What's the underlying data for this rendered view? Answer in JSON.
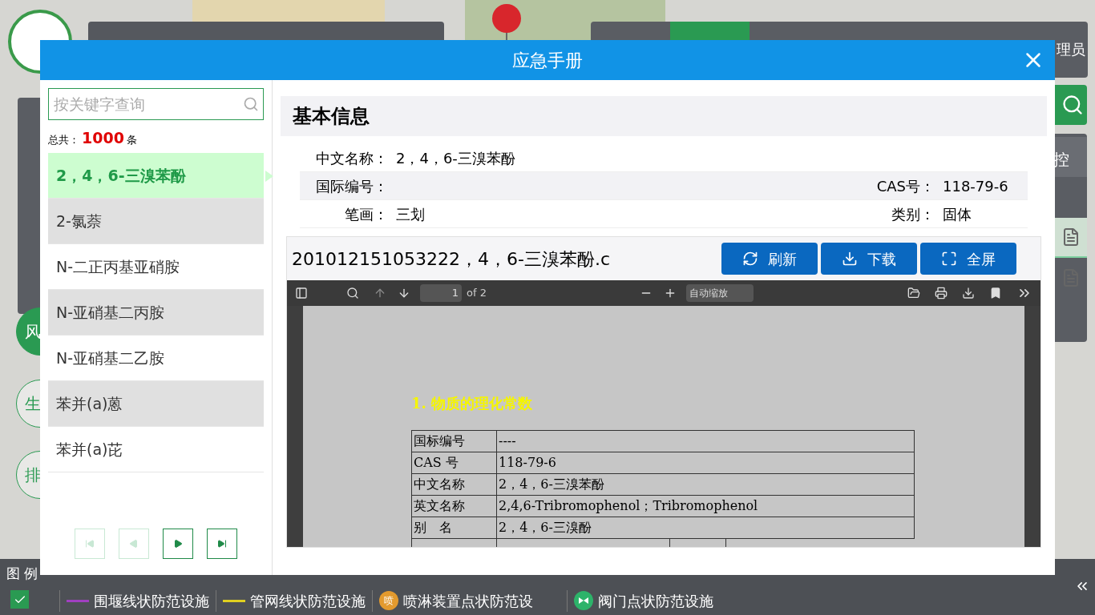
{
  "background": {
    "user_label": "理员",
    "side_circles": [
      {
        "label": "风",
        "selected": true
      },
      {
        "label": "生",
        "selected": false
      },
      {
        "label": "排",
        "selected": false
      }
    ],
    "right_panel_label": "控",
    "right_panel_items": [
      {
        "selected": true
      },
      {
        "selected": false
      }
    ],
    "legend": {
      "title": "图 例",
      "checked": true,
      "items": [
        {
          "kind": "line",
          "color": "#a040c0",
          "label": "围堰线状防范设施"
        },
        {
          "kind": "line",
          "color": "#e0d020",
          "label": "管网线状防范设施"
        },
        {
          "kind": "badge",
          "badge": "喷",
          "color": "#e39a2e",
          "label": "喷淋装置点状防范设"
        },
        {
          "kind": "valve",
          "color": "#2db36a",
          "label": "阀门点状防范设施"
        }
      ]
    }
  },
  "dialog": {
    "title": "应急手册",
    "search": {
      "placeholder": "按关键字查询"
    },
    "total": {
      "prefix": "总共：",
      "count": "1000",
      "suffix": "条"
    },
    "items": [
      {
        "label": "2，4，6-三溴苯酚",
        "selected": true
      },
      {
        "label": "2-氯萘",
        "selected": false
      },
      {
        "label": "N-二正丙基亚硝胺",
        "selected": false
      },
      {
        "label": "N-亚硝基二丙胺",
        "selected": false
      },
      {
        "label": "N-亚硝基二乙胺",
        "selected": false
      },
      {
        "label": "苯并(a)蒽",
        "selected": false
      },
      {
        "label": "苯并(a)芘",
        "selected": false
      }
    ],
    "pager": [
      {
        "kind": "first",
        "disabled": true
      },
      {
        "kind": "prev",
        "disabled": true
      },
      {
        "kind": "next",
        "disabled": false
      },
      {
        "kind": "last",
        "disabled": false
      }
    ],
    "info": {
      "heading": "基本信息",
      "rows": [
        [
          {
            "label": "中文名称：",
            "value": "2，4，6-三溴苯酚"
          }
        ],
        [
          {
            "label": "国际编号："
          },
          {
            "label": "CAS号：",
            "value": "118-79-6"
          }
        ],
        [
          {
            "label": "笔画：",
            "value": "三划"
          },
          {
            "label": "类别：",
            "value": "固体"
          }
        ]
      ]
    },
    "file": {
      "name": "201012151053222，4，6-三溴苯酚.c",
      "buttons": [
        {
          "kind": "refresh",
          "label": "刷新"
        },
        {
          "kind": "download",
          "label": "下载"
        },
        {
          "kind": "fullscreen",
          "label": "全屏"
        }
      ]
    },
    "viewer": {
      "page": "1",
      "page_count": "of 2",
      "zoom": "自动缩放",
      "heading": "1. 物质的理化常数",
      "table": [
        [
          "国标编号",
          "----"
        ],
        [
          "CAS 号",
          "118-79-6"
        ],
        [
          "中文名称",
          "2，4，6-三溴苯酚"
        ],
        [
          "英文名称",
          "2,4,6-Tribromophenol；Tribromophenol"
        ],
        [
          "别　名",
          "2，4，6-三溴酚"
        ]
      ]
    }
  }
}
